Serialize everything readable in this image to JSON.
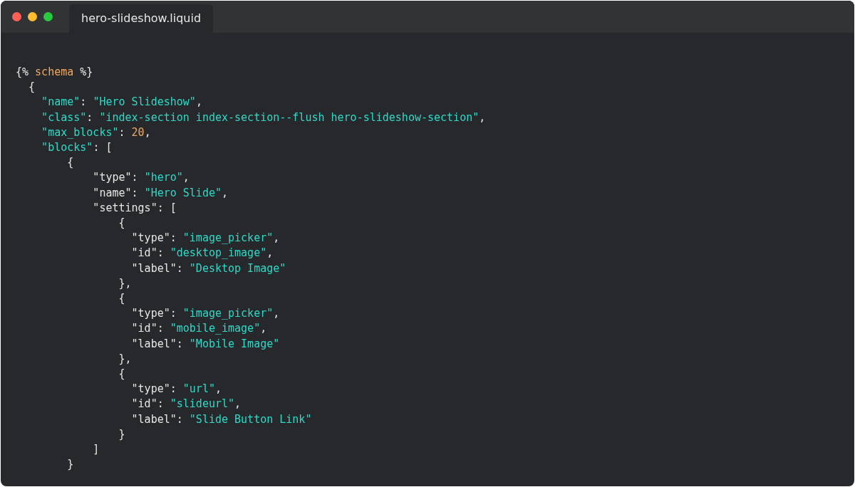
{
  "window": {
    "tab": {
      "label": "hero-slideshow.liquid",
      "selected": true
    }
  },
  "code": [
    {
      "tokens": [
        {
          "kind": "plain",
          "text": "{% "
        },
        {
          "kind": "keyword",
          "text": "schema"
        },
        {
          "kind": "plain",
          "text": " %}"
        }
      ]
    },
    {
      "tokens": [
        {
          "kind": "plain",
          "text": "  {"
        }
      ]
    },
    {
      "tokens": [
        {
          "kind": "string",
          "text": "    \"name\""
        },
        {
          "kind": "plain",
          "text": ": "
        },
        {
          "kind": "string",
          "text": "\"Hero Slideshow\""
        },
        {
          "kind": "plain",
          "text": ","
        }
      ]
    },
    {
      "tokens": [
        {
          "kind": "string",
          "text": "    \"class\""
        },
        {
          "kind": "plain",
          "text": ": "
        },
        {
          "kind": "string",
          "text": "\"index-section index-section--flush hero-slideshow-section\""
        },
        {
          "kind": "plain",
          "text": ","
        }
      ]
    },
    {
      "tokens": [
        {
          "kind": "string",
          "text": "    \"max_blocks\""
        },
        {
          "kind": "plain",
          "text": ": "
        },
        {
          "kind": "number",
          "text": "20"
        },
        {
          "kind": "plain",
          "text": ","
        }
      ]
    },
    {
      "tokens": [
        {
          "kind": "string",
          "text": "    \"blocks\""
        },
        {
          "kind": "plain",
          "text": ": ["
        }
      ]
    },
    {
      "tokens": [
        {
          "kind": "plain",
          "text": "        {"
        }
      ]
    },
    {
      "tokens": [
        {
          "kind": "plain",
          "text": "            \"type\": "
        },
        {
          "kind": "string",
          "text": "\"hero\""
        },
        {
          "kind": "plain",
          "text": ","
        }
      ]
    },
    {
      "tokens": [
        {
          "kind": "plain",
          "text": "            \"name\": "
        },
        {
          "kind": "string",
          "text": "\"Hero Slide\""
        },
        {
          "kind": "plain",
          "text": ","
        }
      ]
    },
    {
      "tokens": [
        {
          "kind": "plain",
          "text": "            \"settings\": ["
        }
      ]
    },
    {
      "tokens": [
        {
          "kind": "plain",
          "text": "                {"
        }
      ]
    },
    {
      "tokens": [
        {
          "kind": "plain",
          "text": "                  \"type\": "
        },
        {
          "kind": "string",
          "text": "\"image_picker\""
        },
        {
          "kind": "plain",
          "text": ","
        }
      ]
    },
    {
      "tokens": [
        {
          "kind": "plain",
          "text": "                  \"id\": "
        },
        {
          "kind": "string",
          "text": "\"desktop_image\""
        },
        {
          "kind": "plain",
          "text": ","
        }
      ]
    },
    {
      "tokens": [
        {
          "kind": "plain",
          "text": "                  \"label\": "
        },
        {
          "kind": "string",
          "text": "\"Desktop Image\""
        }
      ]
    },
    {
      "tokens": [
        {
          "kind": "plain",
          "text": "                },"
        }
      ]
    },
    {
      "tokens": [
        {
          "kind": "plain",
          "text": "                {"
        }
      ]
    },
    {
      "tokens": [
        {
          "kind": "plain",
          "text": "                  \"type\": "
        },
        {
          "kind": "string",
          "text": "\"image_picker\""
        },
        {
          "kind": "plain",
          "text": ","
        }
      ]
    },
    {
      "tokens": [
        {
          "kind": "plain",
          "text": "                  \"id\": "
        },
        {
          "kind": "string",
          "text": "\"mobile_image\""
        },
        {
          "kind": "plain",
          "text": ","
        }
      ]
    },
    {
      "tokens": [
        {
          "kind": "plain",
          "text": "                  \"label\": "
        },
        {
          "kind": "string",
          "text": "\"Mobile Image\""
        }
      ]
    },
    {
      "tokens": [
        {
          "kind": "plain",
          "text": "                },"
        }
      ]
    },
    {
      "tokens": [
        {
          "kind": "plain",
          "text": "                {"
        }
      ]
    },
    {
      "tokens": [
        {
          "kind": "plain",
          "text": "                  \"type\": "
        },
        {
          "kind": "string",
          "text": "\"url\""
        },
        {
          "kind": "plain",
          "text": ","
        }
      ]
    },
    {
      "tokens": [
        {
          "kind": "plain",
          "text": "                  \"id\": "
        },
        {
          "kind": "string",
          "text": "\"slideurl\""
        },
        {
          "kind": "plain",
          "text": ","
        }
      ]
    },
    {
      "tokens": [
        {
          "kind": "plain",
          "text": "                  \"label\": "
        },
        {
          "kind": "string",
          "text": "\"Slide Button Link\""
        }
      ]
    },
    {
      "tokens": [
        {
          "kind": "plain",
          "text": "                }"
        }
      ]
    },
    {
      "tokens": [
        {
          "kind": "plain",
          "text": "            ]"
        }
      ]
    },
    {
      "tokens": [
        {
          "kind": "plain",
          "text": "        }"
        }
      ]
    }
  ]
}
